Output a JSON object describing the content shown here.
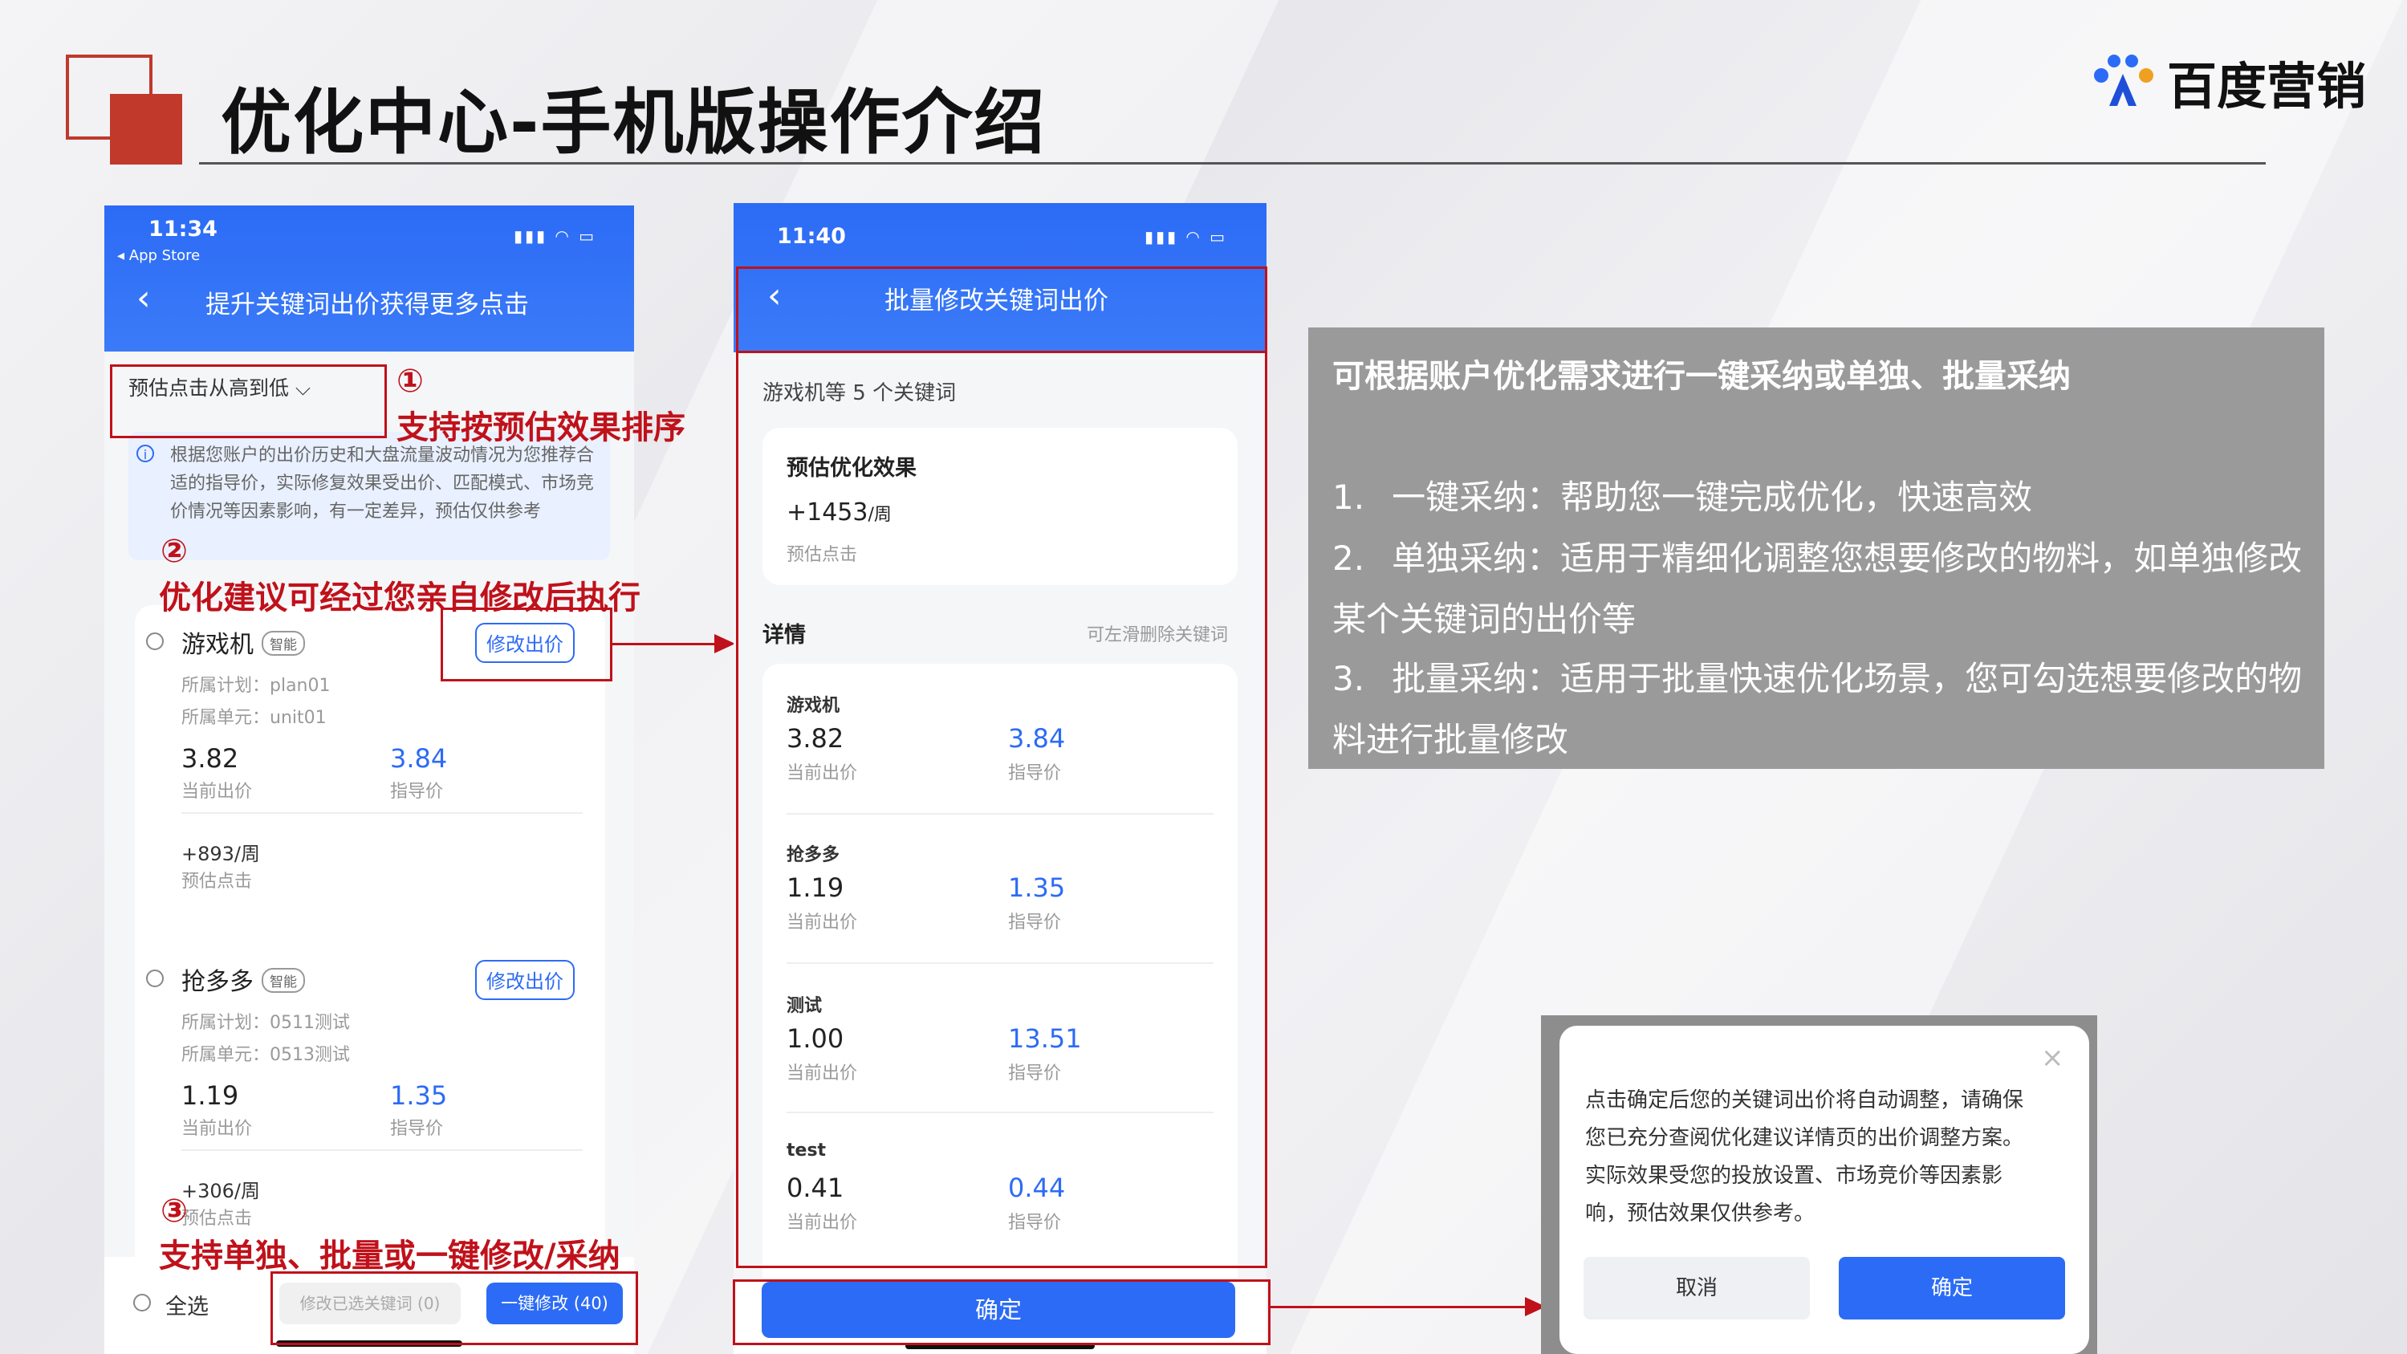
{
  "header": {
    "title": "优化中心-手机版操作介绍",
    "logo_text": "百度营销",
    "accent_color": "#c0392b",
    "brand_blue": "#2c6bf5"
  },
  "phone1": {
    "status_time": "11:34",
    "status_app": "◂ App Store",
    "status_icons": "▮▮▮ ◠ ▭",
    "nav_title": "提升关键词出价获得更多点击",
    "sort_label": "预估点击从高到低 ⌵",
    "notice": "根据您账户的出价历史和大盘流量波动情况为您推荐合适的指导价，实际修复效果受出价、匹配模式、市场竞价情况等因素影响，有一定差异，预估仅供参考",
    "items": [
      {
        "keyword": "游戏机",
        "tag": "智能",
        "plan": "所属计划：plan01",
        "unit": "所属单元：unit01",
        "current": "3.82",
        "current_label": "当前出价",
        "guide": "3.84",
        "guide_label": "指导价",
        "clicks": "+893/周",
        "clicks_label": "预估点击",
        "button": "修改出价"
      },
      {
        "keyword": "抢多多",
        "tag": "智能",
        "plan": "所属计划：0511测试",
        "unit": "所属单元：0513测试",
        "current": "1.19",
        "current_label": "当前出价",
        "guide": "1.35",
        "guide_label": "指导价",
        "clicks": "+306/周",
        "clicks_label": "预估点击",
        "button": "修改出价"
      }
    ],
    "select_all": "全选",
    "modify_selected": "修改已选关键词 (0)",
    "one_click": "一键修改 (40)"
  },
  "annotations": {
    "a1_num": "①",
    "a1": "支持按预估效果排序",
    "a2_num": "②",
    "a2": "优化建议可经过您亲自修改后执行",
    "a3_num": "③",
    "a3": "支持单独、批量或一键修改/采纳"
  },
  "phone2": {
    "status_time": "11:40",
    "status_icons": "▮▮▮ ◠ ▭",
    "nav_title": "批量修改关键词出价",
    "summary": "游戏机等 5 个关键词",
    "effect_title": "预估优化效果",
    "effect_value": "+1453",
    "effect_unit": "/周",
    "effect_label": "预估点击",
    "details_label": "详情",
    "details_hint": "可左滑删除关键词",
    "rows": [
      {
        "keyword": "游戏机",
        "current": "3.82",
        "current_label": "当前出价",
        "guide": "3.84",
        "guide_label": "指导价"
      },
      {
        "keyword": "抢多多",
        "current": "1.19",
        "current_label": "当前出价",
        "guide": "1.35",
        "guide_label": "指导价"
      },
      {
        "keyword": "测试",
        "current": "1.00",
        "current_label": "当前出价",
        "guide": "13.51",
        "guide_label": "指导价"
      },
      {
        "keyword": "test",
        "current": "0.41",
        "current_label": "当前出价",
        "guide": "0.44",
        "guide_label": "指导价"
      }
    ],
    "confirm": "确定"
  },
  "info": {
    "heading": "可根据账户优化需求进行一键采纳或单独、批量采纳",
    "l1_num": "1.",
    "l1": "一键采纳：帮助您一键完成优化，快速高效",
    "l2_num": "2.",
    "l2a": "单独采纳：适用于精细化调整您想要修改的物料，如单独修改",
    "l2b": "某个关键词的出价等",
    "l3_num": "3.",
    "l3a": "批量采纳：适用于批量快速优化场景，您可勾选想要修改的物",
    "l3b": "料进行批量修改"
  },
  "dialog": {
    "close": "×",
    "line1": "点击确定后您的关键词出价将自动调整，请确保",
    "line2": "您已充分查阅优化建议详情页的出价调整方案。",
    "line3": "实际效果受您的投放设置、市场竞价等因素影",
    "line4": "响，预估效果仅供参考。",
    "cancel": "取消",
    "confirm": "确定"
  }
}
